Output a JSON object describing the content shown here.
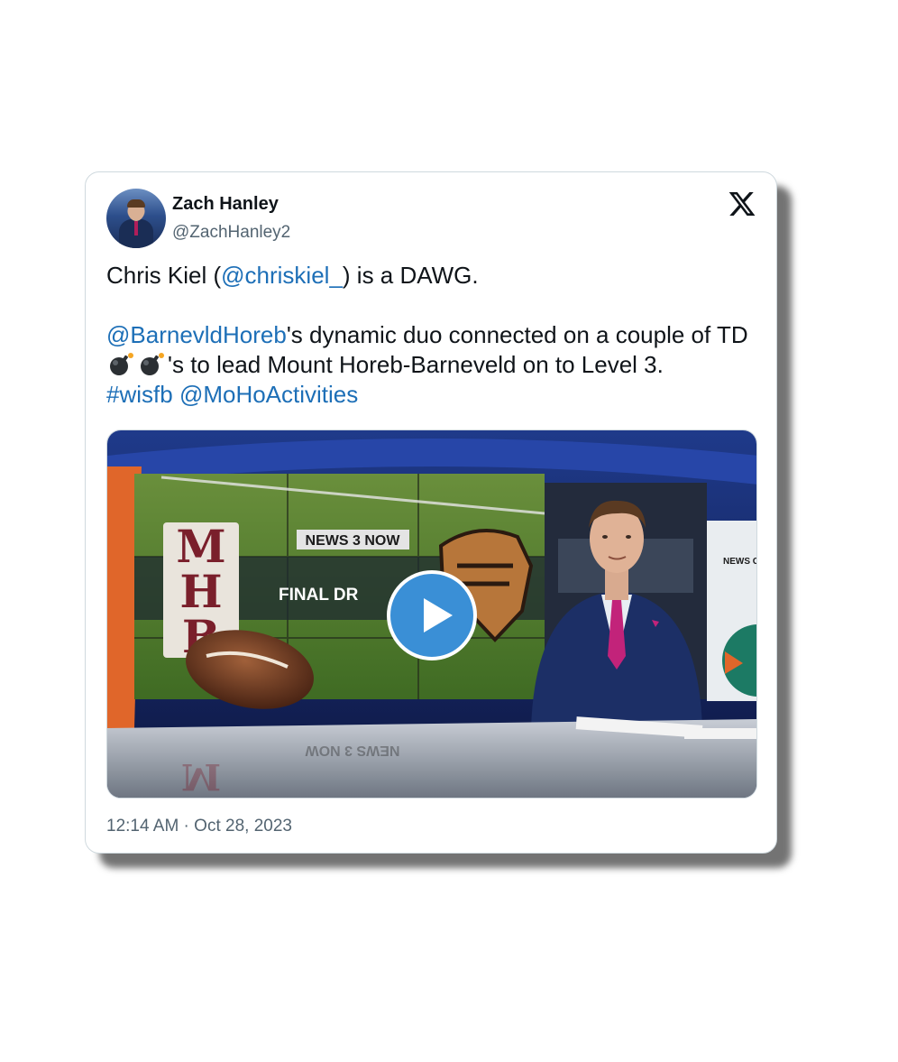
{
  "author": {
    "name": "Zach Hanley",
    "handle": "@ZachHanley2"
  },
  "tweet": {
    "line1_pre": "Chris Kiel (",
    "mention1": "@chriskiel_",
    "line1_post": ") is a DAWG.",
    "mention2": "@BarnevldHoreb",
    "line2_mid": "'s dynamic duo connected on a couple of TD ",
    "line2_end": "'s to lead Mount Horeb-Barneveld on to Level 3.",
    "hashtag": "#wisfb",
    "mention3": "@MoHoActivities"
  },
  "media": {
    "logo_left": "MHB",
    "brand": "NEWS 3 NOW",
    "brand_reflection": "NEWS 3 NOW",
    "segment": "FINAL DR",
    "side_screen": "NEWS CHANN"
  },
  "timestamp": "12:14 AM · Oct 28, 2023",
  "icons": [
    "x-logo-icon",
    "bomb-icon",
    "play-icon"
  ],
  "colors": {
    "link": "#1d6fb7",
    "text": "#0f1419",
    "muted": "#536471",
    "play": "#3a8fd6",
    "maroon": "#7a1f2b"
  }
}
